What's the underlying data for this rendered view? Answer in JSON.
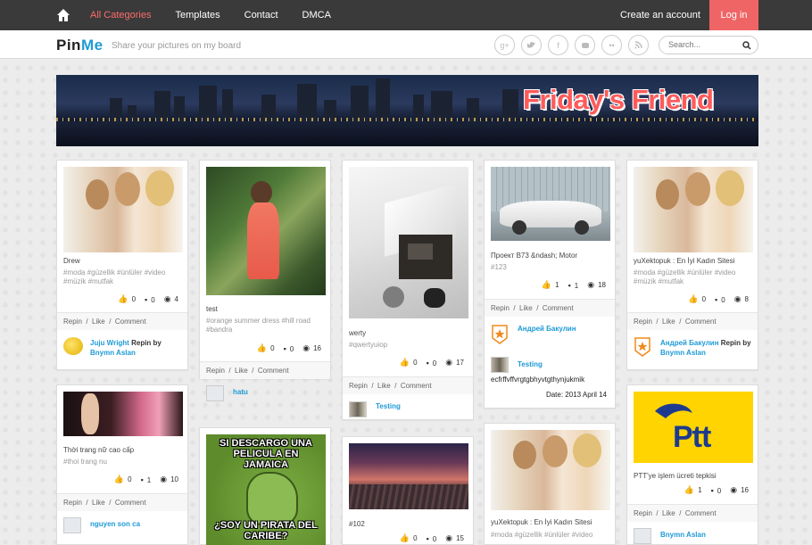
{
  "nav": {
    "items": [
      "All Categories",
      "Templates",
      "Contact",
      "DMCA"
    ],
    "create": "Create an account",
    "login": "Log in"
  },
  "brand": {
    "pin": "Pin",
    "me": "Me",
    "tagline": "Share your pictures on my board"
  },
  "social": [
    "g+",
    "t",
    "f",
    "yt",
    "fl",
    "rss"
  ],
  "search": {
    "placeholder": "Search..."
  },
  "banner": {
    "title": "Friday's Friend"
  },
  "cards": [
    {
      "title": "Drew",
      "tags": "#moda #güzellik #ünlüler #video #müzik #mutfak",
      "likes": "0",
      "comments": "0",
      "views": "4",
      "user": "Juju Wright",
      "repin": "Repin by",
      "by": "Bnymn Aslan"
    },
    {
      "title": "test",
      "tags": "#orange summer dress #hill road #bandra",
      "likes": "0",
      "comments": "0",
      "views": "16",
      "user": "hatu"
    },
    {
      "title": "werty",
      "tags": "#qwertyuiop",
      "likes": "0",
      "comments": "0",
      "views": "17",
      "user": "Testing"
    },
    {
      "title": "Проект В73 &ndash; Motor",
      "tags": "#123",
      "likes": "1",
      "comments": "1",
      "views": "18",
      "user": "Андрей Бакулин",
      "user2": "Testing",
      "note": "ecfrffvffvrgtgbhyvtgthynjukmik",
      "date": "Date: 2013 April 14"
    },
    {
      "title": "yuXektopuk : En İyi Kadın Sitesi",
      "tags": "#moda #güzellik #ünlüler #video #müzik #mutfak",
      "likes": "0",
      "comments": "0",
      "views": "8",
      "user": "Андрей Бакулин",
      "repin": "Repin by",
      "by": "Bnymn Aslan"
    },
    {
      "title": "Thời trang nữ cao cấp",
      "tags": "#thoi trang nu",
      "likes": "0",
      "comments": "1",
      "views": "10",
      "user": "nguyen son ca"
    },
    {
      "meme_top": "SI DESCARGO UNA PELICULA EN JAMAICA",
      "meme_bottom": "¿SOY UN PIRATA DEL CARIBE?"
    },
    {
      "title": "#102",
      "likes": "0",
      "comments": "0",
      "views": "15"
    },
    {
      "title": "yuXektopuk : En İyi Kadın Sitesi",
      "tags": "#moda #güzellik #ünlüler #video"
    },
    {
      "title": "PTT'ye işlem ücreti tepkisi",
      "logo": "Ptt",
      "likes": "1",
      "comments": "0",
      "views": "16",
      "user": "Bnymn Aslan"
    }
  ],
  "actions": {
    "repin": "Repin",
    "like": "Like",
    "comment": "Comment",
    "sep": "/"
  }
}
